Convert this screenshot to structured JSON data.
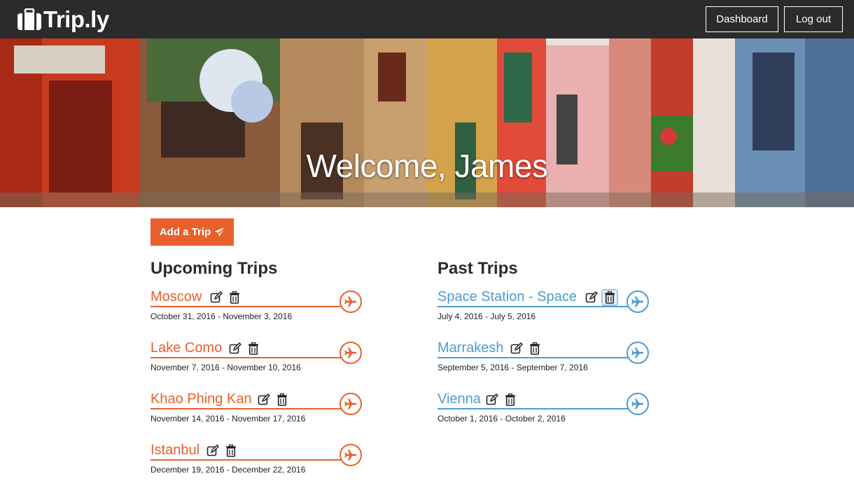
{
  "brand": {
    "name": "Trip.ly",
    "icon": "suitcase-icon"
  },
  "nav": {
    "dashboard_label": "Dashboard",
    "logout_label": "Log out"
  },
  "hero": {
    "title": "Welcome, James"
  },
  "actions": {
    "add_trip_label": "Add a Trip",
    "add_trip_icon": "paper-plane-icon"
  },
  "colors": {
    "accent": "#e8602c",
    "past": "#4f9bd0",
    "navbar": "#2b2b2b"
  },
  "upcoming": {
    "title": "Upcoming Trips",
    "trips": [
      {
        "name": "Moscow",
        "dates": "October 31, 2016 - November 3, 2016"
      },
      {
        "name": "Lake Como",
        "dates": "November 7, 2016 - November 10, 2016"
      },
      {
        "name": "Khao Phing Kan",
        "dates": "November 14, 2016 - November 17, 2016"
      },
      {
        "name": "Istanbul",
        "dates": "December 19, 2016 - December 22, 2016"
      }
    ]
  },
  "past": {
    "title": "Past Trips",
    "trips": [
      {
        "name": "Space Station - Space",
        "dates": "July 4, 2016 - July 5, 2016"
      },
      {
        "name": "Marrakesh",
        "dates": "September 5, 2016 - September 7, 2016"
      },
      {
        "name": "Vienna",
        "dates": "October 1, 2016 - October 2, 2016"
      }
    ]
  }
}
